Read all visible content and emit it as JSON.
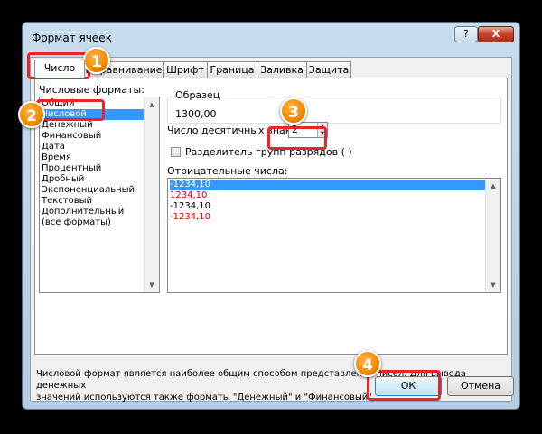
{
  "window": {
    "title": "Формат ячеек",
    "help_label": "?",
    "close_label": "X"
  },
  "tabs": [
    "Число",
    "Выравнивание",
    "Шрифт",
    "Граница",
    "Заливка",
    "Защита"
  ],
  "formats": {
    "label": "Числовые форматы:",
    "items": [
      "Общий",
      "Числовой",
      "Денежный",
      "Финансовый",
      "Дата",
      "Время",
      "Процентный",
      "Дробный",
      "Экспоненциальный",
      "Текстовый",
      "Дополнительный",
      "(все форматы)"
    ],
    "selected": "Числовой"
  },
  "sample": {
    "label": "Образец",
    "value": "1300,00"
  },
  "decimals": {
    "label": "Число десятичных знаков:",
    "value": "2"
  },
  "separator": {
    "label": "Разделитель групп разрядов ( )",
    "checked": false
  },
  "negative": {
    "label": "Отрицательные числа:",
    "items": [
      {
        "text": "-1234,10",
        "color": "#000000",
        "selected": true
      },
      {
        "text": "1234,10",
        "color": "#e00000",
        "selected": false
      },
      {
        "text": "-1234,10",
        "color": "#000000",
        "selected": false
      },
      {
        "text": "-1234,10",
        "color": "#e00000",
        "selected": false
      }
    ]
  },
  "description": {
    "line1": "Числовой формат является наиболее общим способом представления чисел. Для вывода денежных",
    "line2": "значений используются также форматы \"Денежный\" и \"Финансовый\"."
  },
  "buttons": {
    "ok": "ОК",
    "cancel": "Отмена"
  },
  "markers": [
    "1",
    "2",
    "3",
    "4"
  ],
  "accent": {
    "highlight": "#e8262a",
    "badge": "#f08a00",
    "selection": "#3399ff"
  }
}
